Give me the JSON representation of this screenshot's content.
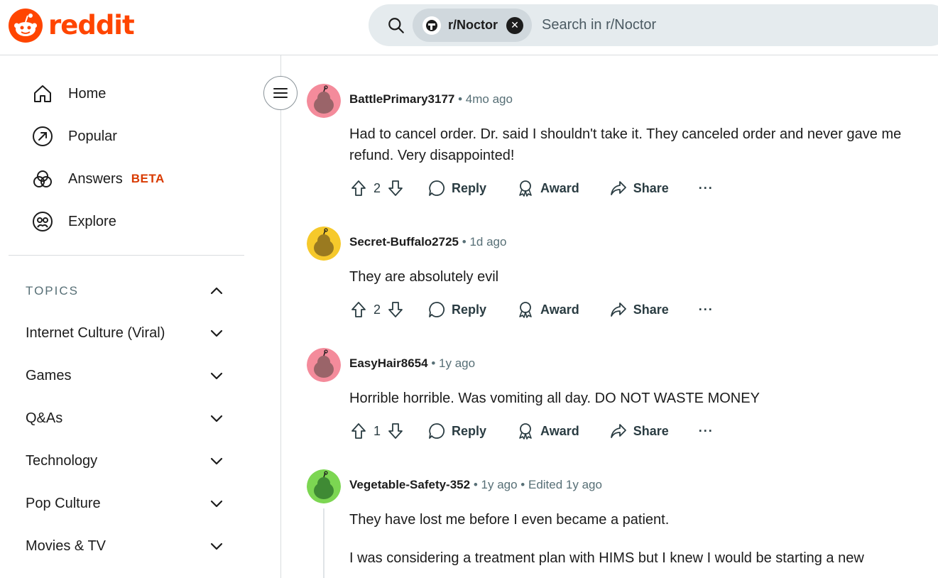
{
  "header": {
    "logo_text": "reddit",
    "search_chip": "r/Noctor",
    "search_placeholder": "Search in r/Noctor",
    "brand_color": "#ff4500"
  },
  "sidebar": {
    "nav": [
      {
        "label": "Home",
        "icon": "home-icon"
      },
      {
        "label": "Popular",
        "icon": "popular-icon"
      },
      {
        "label": "Answers",
        "icon": "answers-icon",
        "badge": "BETA"
      },
      {
        "label": "Explore",
        "icon": "explore-icon"
      }
    ],
    "topics_title": "TOPICS",
    "topics": [
      "Internet Culture (Viral)",
      "Games",
      "Q&As",
      "Technology",
      "Pop Culture",
      "Movies & TV"
    ]
  },
  "comments": [
    {
      "author": "BattlePrimary3177",
      "time": "4mo ago",
      "body": "Had to cancel order. Dr. said I shouldn't take it. They canceled order and never gave me refund. Very disappointed!",
      "votes": "2",
      "avatar_color": "#f48b9b"
    },
    {
      "author": "Secret-Buffalo2725",
      "time": "1d ago",
      "body": "They are absolutely evil",
      "votes": "2",
      "avatar_color": "#f6c92b"
    },
    {
      "author": "EasyHair8654",
      "time": "1y ago",
      "body": "Horrible horrible. Was vomiting all day. DO NOT WASTE MONEY",
      "votes": "1",
      "avatar_color": "#f48b9b"
    },
    {
      "author": "Vegetable-Safety-352",
      "time": "1y ago",
      "edited": "Edited 1y ago",
      "body": "They have lost me before I even became a patient.",
      "body2": "I was considering a treatment plan with HIMS but I knew I would be starting a new",
      "avatar_color": "#7cd652"
    }
  ],
  "actions": {
    "reply": "Reply",
    "award": "Award",
    "share": "Share",
    "more": "···"
  }
}
